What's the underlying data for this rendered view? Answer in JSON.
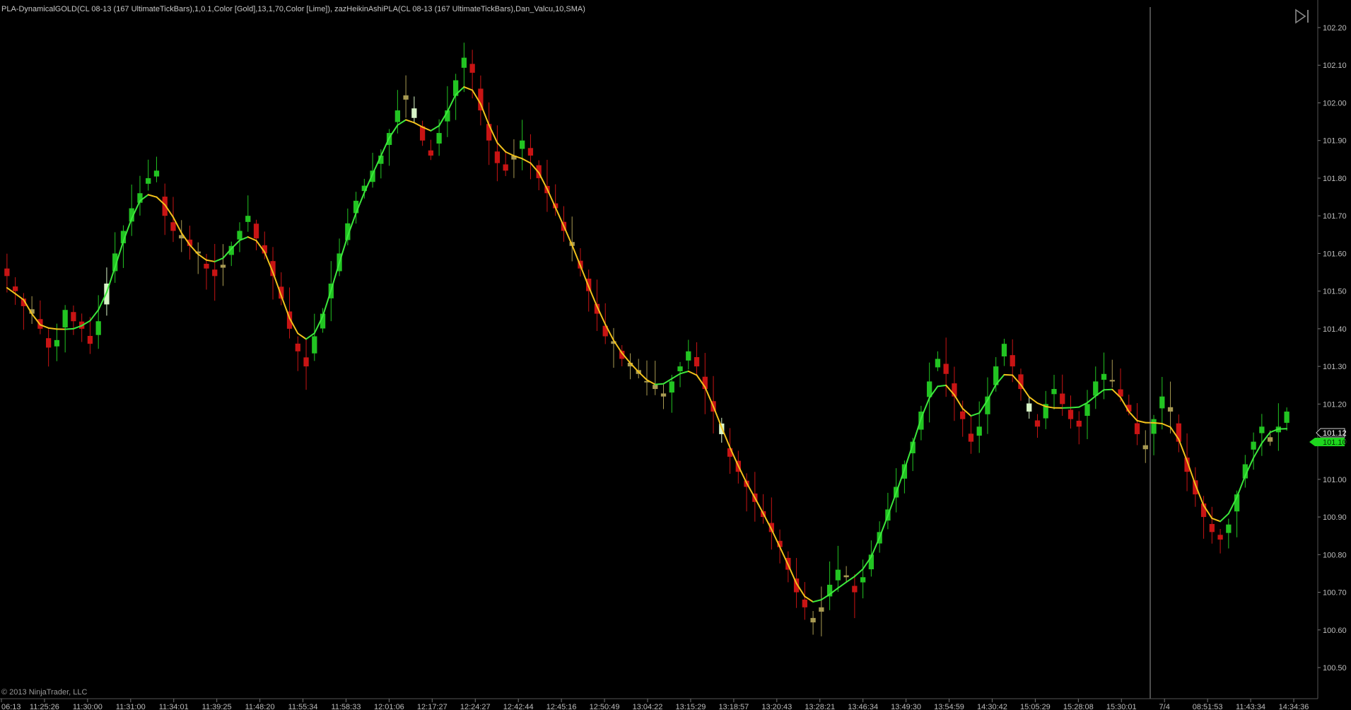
{
  "header": {
    "title": "PLA-DynamicalGOLD(CL 08-13 (167 UltimateTickBars),1,0.1,Color [Gold],13,1,70,Color [Lime]), zazHeikinAshiPLA(CL 08-13 (167 UltimateTickBars),Dan_Valcu,10,SMA)"
  },
  "footer": {
    "copyright": "© 2013 NinjaTrader, LLC"
  },
  "icons": {
    "scroll_to_end": "skip-to-end-icon"
  },
  "colors": {
    "background": "#000000",
    "bull": "#22c422",
    "bear": "#c81414",
    "neutral": "#a89a52",
    "highlight": "#d8f5c8",
    "line_up": "#3ce83c",
    "line_down": "#f2c21b",
    "current_price_tag": "#1ed61e"
  },
  "chart_data": {
    "type": "candlestick",
    "title": "",
    "ylim": [
      100.45,
      102.25
    ],
    "yticks": [
      "102.20",
      "102.10",
      "102.00",
      "101.90",
      "101.80",
      "101.70",
      "101.60",
      "101.50",
      "101.40",
      "101.30",
      "101.20",
      "101.10",
      "101.00",
      "100.90",
      "100.80",
      "100.70",
      "100.60",
      "100.50"
    ],
    "xticks": [
      "06:13",
      "11:25:26",
      "11:30:00",
      "11:31:00",
      "11:34:01",
      "11:39:25",
      "11:48:20",
      "11:55:34",
      "11:58:33",
      "12:01:06",
      "12:17:27",
      "12:24:27",
      "12:42:44",
      "12:45:16",
      "12:50:49",
      "13:04:22",
      "13:15:29",
      "13:18:57",
      "13:20:43",
      "13:28:21",
      "13:46:34",
      "13:49:30",
      "13:54:59",
      "14:30:42",
      "15:05:29",
      "15:28:08",
      "15:30:01",
      "7/4",
      "08:51:53",
      "11:43:34",
      "14:34:36"
    ],
    "session_break_label": "7/4",
    "current_price_labels": [
      "101.12",
      "101.10"
    ],
    "ohlc_closes": [
      101.54,
      101.5,
      101.46,
      101.44,
      101.4,
      101.35,
      101.37,
      101.45,
      101.42,
      101.4,
      101.36,
      101.42,
      101.52,
      101.6,
      101.66,
      101.72,
      101.76,
      101.8,
      101.82,
      101.7,
      101.66,
      101.64,
      101.62,
      101.6,
      101.56,
      101.54,
      101.57,
      101.62,
      101.66,
      101.7,
      101.64,
      101.6,
      101.54,
      101.48,
      101.4,
      101.34,
      101.3,
      101.38,
      101.44,
      101.52,
      101.6,
      101.68,
      101.74,
      101.78,
      101.82,
      101.86,
      101.92,
      101.98,
      102.02,
      101.96,
      101.9,
      101.86,
      101.92,
      101.98,
      102.06,
      102.12,
      102.08,
      101.98,
      101.9,
      101.84,
      101.82,
      101.86,
      101.9,
      101.86,
      101.8,
      101.76,
      101.72,
      101.66,
      101.62,
      101.56,
      101.5,
      101.44,
      101.38,
      101.36,
      101.32,
      101.3,
      101.28,
      101.26,
      101.24,
      101.22,
      101.26,
      101.3,
      101.34,
      101.3,
      101.24,
      101.18,
      101.12,
      101.06,
      101.02,
      100.98,
      100.94,
      100.9,
      100.86,
      100.82,
      100.76,
      100.7,
      100.66,
      100.62,
      100.66,
      100.72,
      100.76,
      100.74,
      100.7,
      100.74,
      100.8,
      100.86,
      100.92,
      100.98,
      101.04,
      101.1,
      101.18,
      101.26,
      101.32,
      101.28,
      101.22,
      101.16,
      101.1,
      101.14,
      101.22,
      101.3,
      101.36,
      101.3,
      101.24,
      101.18,
      101.14,
      101.2,
      101.24,
      101.2,
      101.16,
      101.14,
      101.2,
      101.26,
      101.28,
      101.26,
      101.22,
      101.18,
      101.12,
      101.08,
      101.16,
      101.22,
      101.18,
      101.1,
      101.02,
      100.96,
      100.9,
      100.86,
      100.84,
      100.88,
      100.96,
      101.04,
      101.1,
      101.14,
      101.1,
      101.14,
      101.18
    ]
  }
}
